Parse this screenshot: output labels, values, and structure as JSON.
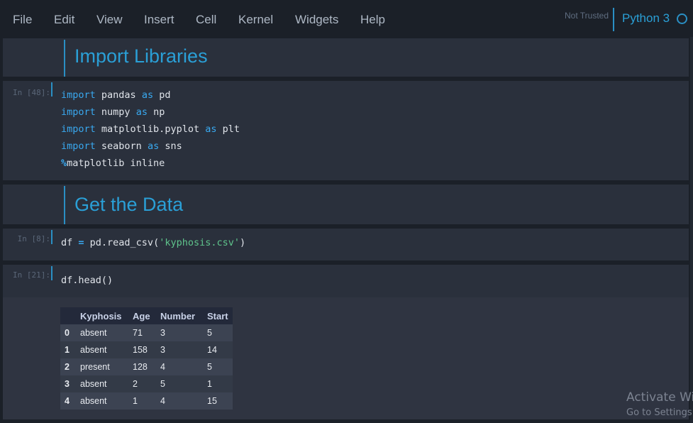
{
  "menubar": {
    "items": [
      "File",
      "Edit",
      "View",
      "Insert",
      "Cell",
      "Kernel",
      "Widgets",
      "Help"
    ],
    "trust_status": "Not Trusted",
    "kernel_name": "Python 3",
    "kernel_status_icon": "kernel-idle-circle"
  },
  "cells": {
    "md1": {
      "heading": "Import Libraries"
    },
    "code1": {
      "prompt": "In [48]:",
      "lines": [
        [
          {
            "t": "import",
            "c": "kw"
          },
          {
            "t": " pandas "
          },
          {
            "t": "as",
            "c": "kw"
          },
          {
            "t": " pd"
          }
        ],
        [
          {
            "t": "import",
            "c": "kw"
          },
          {
            "t": " numpy "
          },
          {
            "t": "as",
            "c": "kw"
          },
          {
            "t": " np"
          }
        ],
        [
          {
            "t": "import",
            "c": "kw"
          },
          {
            "t": " matplotlib.pyplot "
          },
          {
            "t": "as",
            "c": "kw"
          },
          {
            "t": " plt"
          }
        ],
        [
          {
            "t": "import",
            "c": "kw"
          },
          {
            "t": " seaborn "
          },
          {
            "t": "as",
            "c": "kw"
          },
          {
            "t": " sns"
          }
        ],
        [
          {
            "t": "%",
            "c": "op"
          },
          {
            "t": "matplotlib inline"
          }
        ]
      ]
    },
    "md2": {
      "heading": "Get the Data"
    },
    "code2": {
      "prompt": "In [8]:",
      "lines": [
        [
          {
            "t": "df "
          },
          {
            "t": "=",
            "c": "op"
          },
          {
            "t": " pd.read_csv("
          },
          {
            "t": "'kyphosis.csv'",
            "c": "str"
          },
          {
            "t": ")"
          }
        ]
      ]
    },
    "code3": {
      "prompt": "In [21]:",
      "lines": [
        [
          {
            "t": "df.head()"
          }
        ]
      ],
      "output": {
        "columns": [
          "",
          "Kyphosis",
          "Age",
          "Number",
          "Start"
        ],
        "rows": [
          [
            "0",
            "absent",
            "71",
            "3",
            "5"
          ],
          [
            "1",
            "absent",
            "158",
            "3",
            "14"
          ],
          [
            "2",
            "present",
            "128",
            "4",
            "5"
          ],
          [
            "3",
            "absent",
            "2",
            "5",
            "1"
          ],
          [
            "4",
            "absent",
            "1",
            "4",
            "15"
          ]
        ]
      }
    }
  },
  "watermark": {
    "line1": "Activate Windows",
    "line2": "Go to Settings to activate Windows."
  },
  "colors": {
    "accent": "#2a9fd6",
    "keyword": "#39a9f0",
    "string": "#5fc48c",
    "background": "#1b2028",
    "cell_background": "#2a303c"
  }
}
